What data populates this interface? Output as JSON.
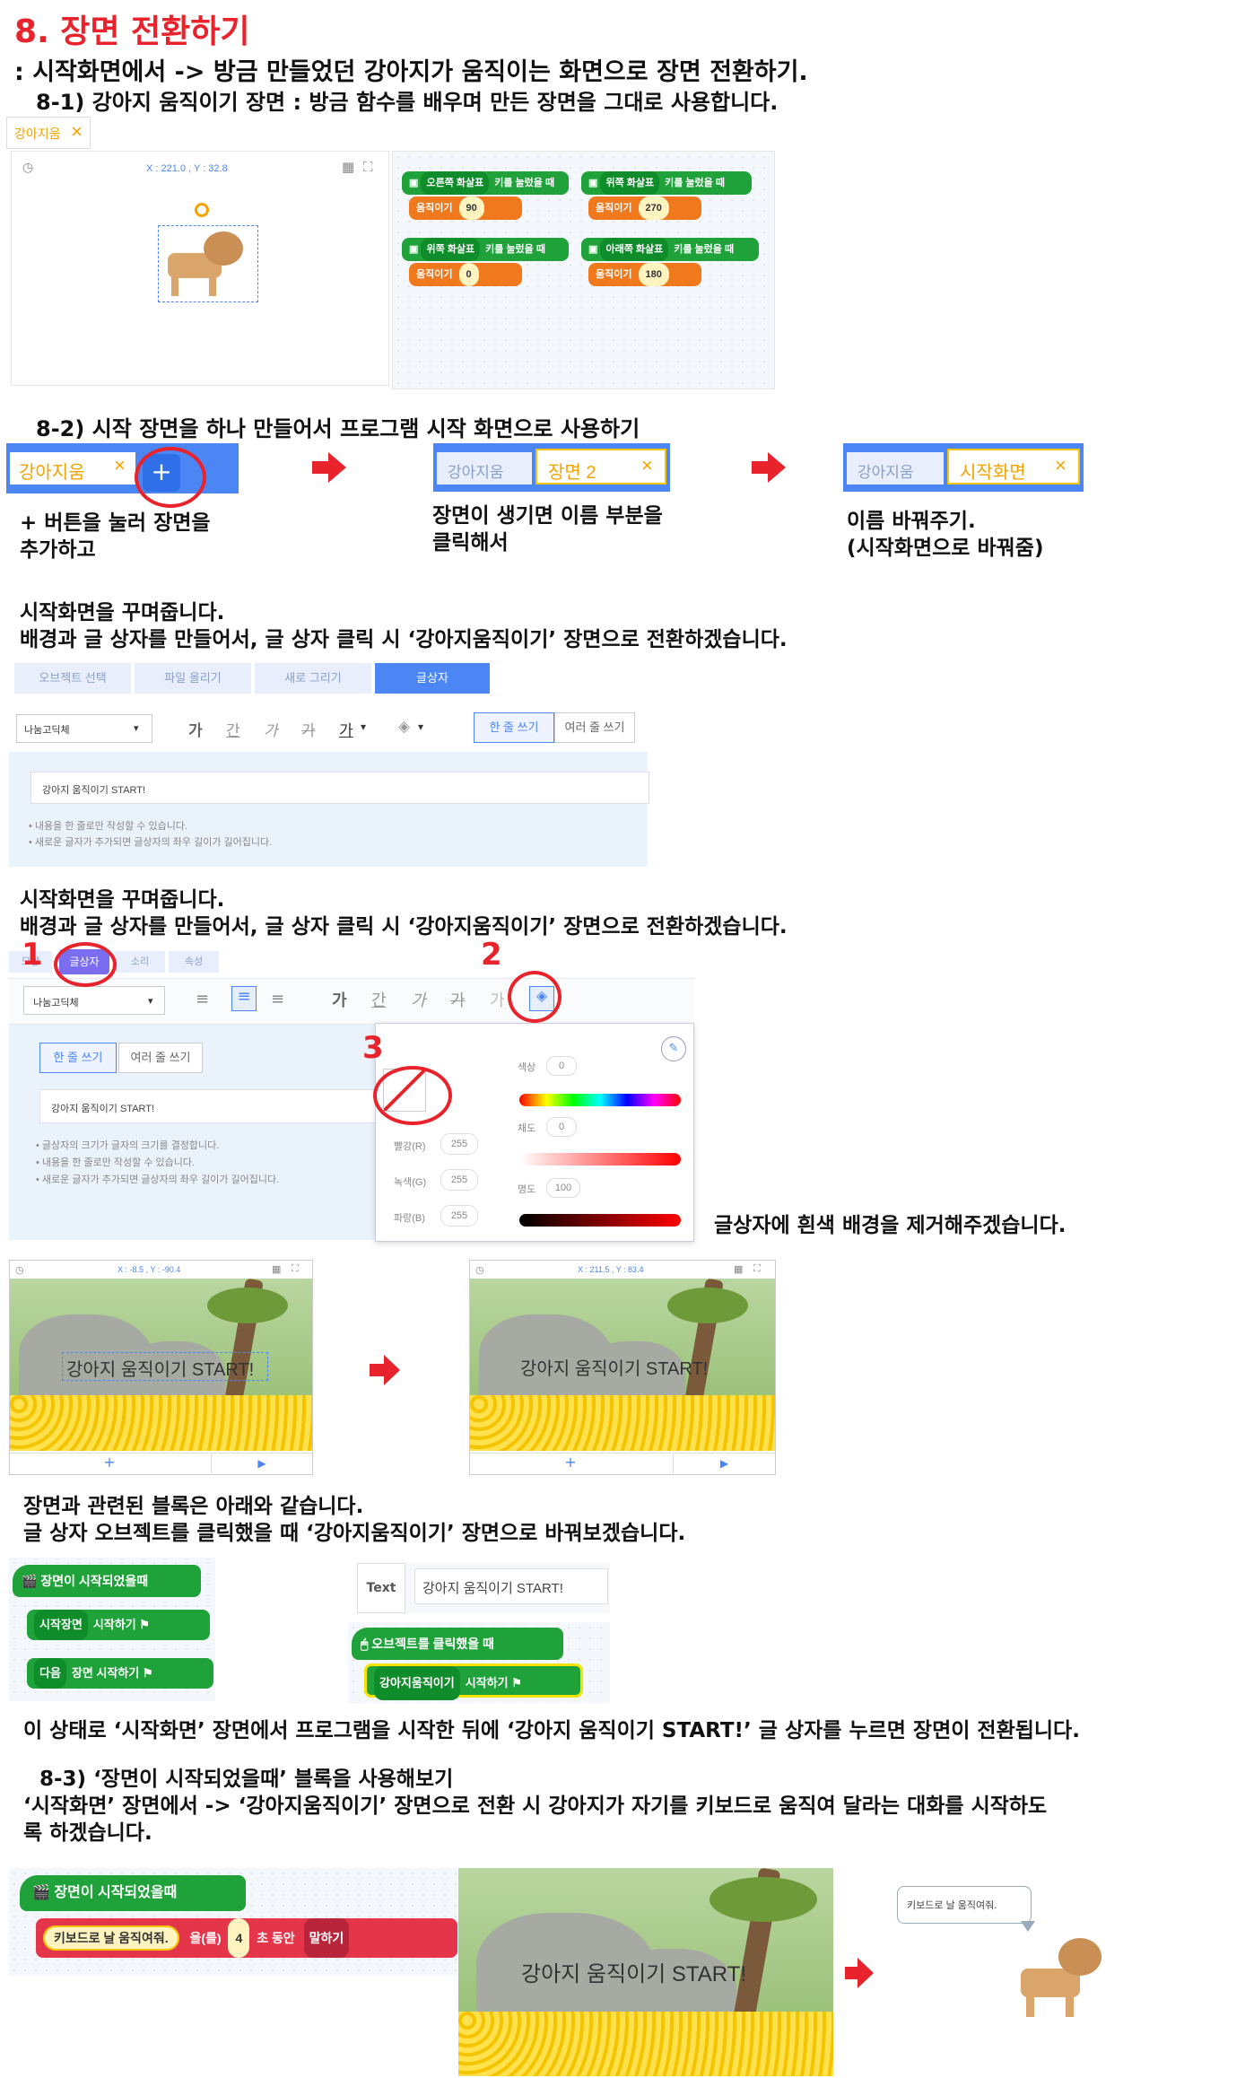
{
  "heading": {
    "title": "8. 장면 전환하기",
    "intro": ":  시작화면에서 -> 방금 만들었던 강아지가 움직이는 화면으로 장면 전환하기.",
    "step1": "8-1) 강아지 움직이기 장면 : 방금 함수를 배우며 만든 장면을 그대로 사용합니다."
  },
  "shot1": {
    "tab": "강아지움",
    "close": "×",
    "coords": "X : 221.0 , Y : 32.8",
    "blocks": [
      {
        "key": "오른쪽 화살표",
        "hat": "키를 눌렀을 때",
        "action": "움직이기",
        "value": "90"
      },
      {
        "key": "위쪽 화살표",
        "hat": "키를 눌렀을 때",
        "action": "움직이기",
        "value": "270"
      },
      {
        "key": "위쪽 화살표",
        "hat": "키를 눌렀을 때",
        "action": "움직이기",
        "value": "0"
      },
      {
        "key": "아래쪽 화살표",
        "hat": "키를 눌렀을 때",
        "action": "움직이기",
        "value": "180"
      }
    ]
  },
  "step2": {
    "title": "8-2) 시작 장면을 하나 만들어서 프로그램 시작 화면으로 사용하기",
    "tabA": "강아지움",
    "tabA2": "강아지움",
    "tabA3": "강아지움",
    "plus": "+",
    "tabB": "장면 2",
    "tabC": "시작화면",
    "close": "×",
    "capA1": "+ 버튼을 눌러 장면을",
    "capA2": "추가하고",
    "capB1": "장면이 생기면 이름 부분을",
    "capB2": "클릭해서",
    "capC1": "이름 바꿔주기.",
    "capC2": "(시작화면으로 바꿔줌)"
  },
  "deco1": {
    "line1": "시작화면을 꾸며줍니다.",
    "line2": "배경과 글 상자를 만들어서, 글 상자 클릭 시 ‘강아지움직이기’ 장면으로 전환하겠습니다.",
    "tabs": [
      "오브젝트 선택",
      "파일 올리기",
      "새로 그리기",
      "글상자"
    ],
    "font": "나눔고딕체",
    "styles": [
      "가",
      "간",
      "가",
      "가",
      "가"
    ],
    "single": "한 줄 쓰기",
    "multi": "여러 줄 쓰기",
    "text": "강아지 움직이기 START!",
    "note1": "• 내용을 한 줄로만 작성할 수 있습니다.",
    "note2": "• 새로운 글자가 추가되면 글상자의 좌우 길이가 길어집니다."
  },
  "deco2": {
    "line1": "시작화면을 꾸며줍니다.",
    "line2": "배경과 글 상자를 만들어서, 글 상자 클릭 시 ‘강아지움직이기’ 장면으로 전환하겠습니다.",
    "n1": "1",
    "n2": "2",
    "n3": "3",
    "tabs": [
      "모양",
      "글상자",
      "소리",
      "속성"
    ],
    "font": "나눔고딕체",
    "single": "한 줄 쓰기",
    "multi": "여러 줄 쓰기",
    "text": "강아지 움직이기 START!",
    "note1": "• 글상자의 크기가 글자의 크기를 결정합니다.",
    "note2": "• 내용을 한 줄로만 작성할 수 있습니다.",
    "note3": "• 새로운 글자가 추가되면 글상자의 좌우 길이가 길어집니다.",
    "color_label": "색상",
    "color_val": "0",
    "sat_label": "채도",
    "sat_val": "0",
    "bright_label": "명도",
    "bright_val": "100",
    "r_label": "빨강(R)",
    "r_val": "255",
    "g_label": "녹색(G)",
    "g_val": "255",
    "b_label": "파랑(B)",
    "b_val": "255",
    "caption": "글상자에 흰색 배경을 제거해주겠습니다."
  },
  "scenes": {
    "coordsA": "X : -8.5 , Y : -90.4",
    "coordsB": "X : 211.5 , Y : 83.4",
    "text": "강아지 움직이기 START!",
    "plus": "+",
    "play": "▶"
  },
  "blocks2": {
    "line1": "장면과 관련된 블록은 아래와 같습니다.",
    "line2": "글 상자 오브젝트를 클릭했을 때 ‘강아지움직이기’ 장면으로 바꿔보겠습니다.",
    "hat1": "장면이 시작되었을때",
    "b1_dd": "시작장면",
    "b1_act": "시작하기",
    "b2_dd": "다음",
    "b2_act": "장면 시작하기",
    "text_icon": "Text",
    "text_val": "강아지 움직이기 START!",
    "hat2": "오브젝트를 클릭했을 때",
    "b3_dd": "강아지움직이기",
    "b3_act": "시작하기",
    "summary": "이 상태로 ‘시작화면’ 장면에서 프로그램을 시작한 뒤에 ‘강아지 움직이기 START!’ 글 상자를 누르면 장면이 전환됩니다."
  },
  "step3": {
    "title": "8-3) ‘장면이 시작되었을때’ 블록을 사용해보기",
    "line1": "‘시작화면’ 장면에서 -> ‘강아지움직이기’ 장면으로 전환 시 강아지가 자기를 키보드로 움직여 달라는 대화를 시작하도",
    "line2": "록 하겠습니다.",
    "hat": "장면이 시작되었을때",
    "say_text": "키보드로 날 움직여줘.",
    "say_mid": "을(를)",
    "say_num": "4",
    "say_unit": "초 동안",
    "say_dd": "말하기",
    "scene_text": "강아지 움직이기 START!",
    "bubble": "키보드로 날 움직여줘."
  }
}
